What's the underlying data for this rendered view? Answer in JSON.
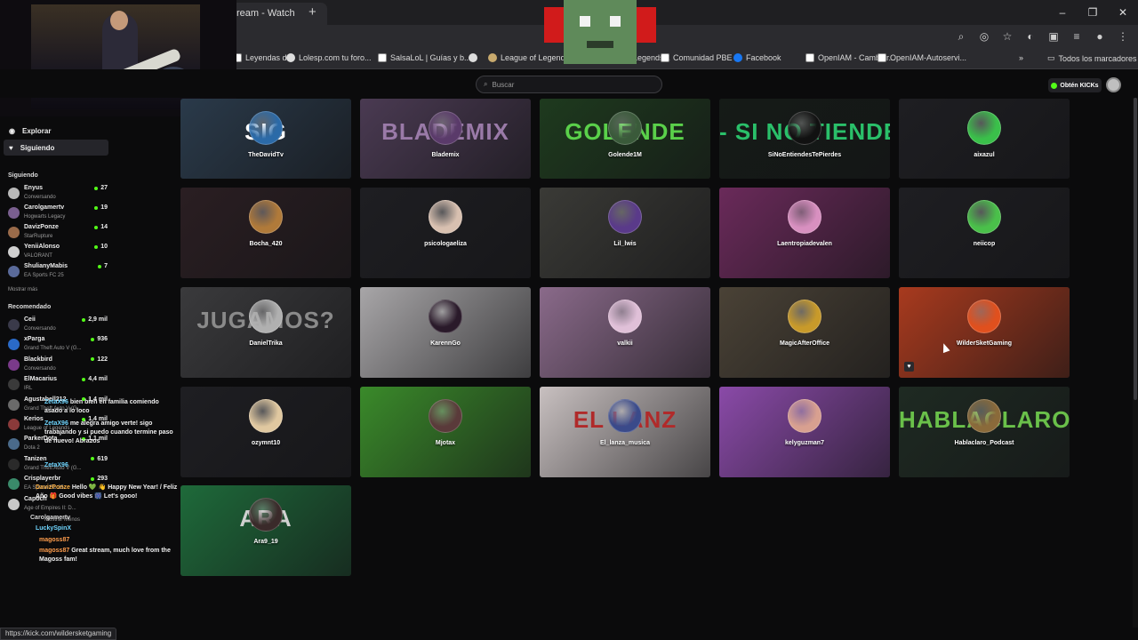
{
  "browser": {
    "tab_title": "ream - Watch",
    "tab_close": "×",
    "new_tab": "+",
    "window_controls": [
      "–",
      "❐",
      "✕"
    ],
    "toolbar_icons": [
      "zoom-icon",
      "eye-off-icon",
      "star-icon",
      "extension-icon",
      "puzzle-icon",
      "tabs-icon",
      "profile-icon",
      "menu-icon"
    ],
    "bookmarks": [
      {
        "label": "Leyendas d...",
        "icon": "sq"
      },
      {
        "label": "Lolesp.com tu foro...",
        "icon": "circle"
      },
      {
        "label": "SalsaLoL | Guías y b...",
        "icon": "sq"
      },
      {
        "label": "",
        "icon": "circle"
      },
      {
        "label": "League of Legends",
        "icon": "lol"
      },
      {
        "label": "Legends...",
        "icon": "circle"
      },
      {
        "label": "Comunidad PBE",
        "icon": "sq"
      },
      {
        "label": "Facebook",
        "icon": "fb"
      },
      {
        "label": "OpenIAM - Cambiar...",
        "icon": "sq"
      },
      {
        "label": "OpenIAM-Autoservi...",
        "icon": "sq"
      }
    ],
    "bookmarks_overflow": "»",
    "all_bookmarks": "Todos los marcadores",
    "status_url": "https://kick.com/wildersketgaming"
  },
  "header": {
    "search_placeholder": "Buscar",
    "kicks_button": "Obtén KICKs"
  },
  "sidebar": {
    "nav": [
      {
        "label": "Explorar",
        "icon": "compass-icon"
      },
      {
        "label": "Siguiendo",
        "icon": "heart-icon"
      }
    ],
    "following_title": "Siguiendo",
    "following": [
      {
        "name": "Enyus",
        "game": "Conversando",
        "viewers": "27",
        "color": "#b9b9b9"
      },
      {
        "name": "Carolgamertv",
        "game": "Hogwarts Legacy",
        "viewers": "19",
        "color": "#7a5f8f"
      },
      {
        "name": "DavizPonze",
        "game": "StarRupture",
        "viewers": "14",
        "color": "#9a6b4a"
      },
      {
        "name": "YeniiAlonso",
        "game": "VALORANT",
        "viewers": "10",
        "color": "#d0d0d0"
      },
      {
        "name": "ShulianyMabis",
        "game": "EA Sports FC 25",
        "viewers": "7",
        "color": "#5a6a9a"
      }
    ],
    "show_more": "Mostrar más",
    "recommended_title": "Recomendado",
    "recommended": [
      {
        "name": "Ceii",
        "game": "Conversando",
        "viewers": "2,9 mil",
        "color": "#3a3a4a"
      },
      {
        "name": "xParga",
        "game": "Grand Theft Auto V (G...",
        "viewers": "936",
        "color": "#2a6ac8"
      },
      {
        "name": "Blackbird",
        "game": "Conversando",
        "viewers": "122",
        "color": "#7a3a8a"
      },
      {
        "name": "ElMacarius",
        "game": "IRL",
        "viewers": "4,4 mil",
        "color": "#3a3a3a"
      },
      {
        "name": "Agustabell212",
        "game": "Grand Theft Auto V (G...",
        "viewers": "1,4 mil",
        "color": "#6a6a6a"
      },
      {
        "name": "Kerios",
        "game": "League of Legends",
        "viewers": "1,4 mil",
        "color": "#8a3a3a"
      },
      {
        "name": "ParkerDota",
        "game": "Dota 2",
        "viewers": "1,1 mil",
        "color": "#4a6a8a"
      },
      {
        "name": "Tanizen",
        "game": "Grand Theft Auto V (G...",
        "viewers": "619",
        "color": "#2a2a2a"
      },
      {
        "name": "Crisplayerbr",
        "game": "EA Sports FC 25",
        "viewers": "293",
        "color": "#3a8a6a"
      },
      {
        "name": "Capoch",
        "game": "Age of Empires II: D...",
        "viewers": "",
        "color": "#c8c8c8"
      }
    ],
    "show_less": "Mostrar Menos"
  },
  "chat": [
    {
      "user": "ZetaX96",
      "text": "bien bien en familia comiendo asado a lo loco",
      "color": "#6fd6ff"
    },
    {
      "user": "ZetaX96",
      "text": "me alegra amigo verte! sigo trabajando y si puedo cuando termine paso de nuevo! Abrazos",
      "color": "#6fd6ff"
    },
    {
      "user": "ZetaX96",
      "text": "",
      "color": "#6fd6ff"
    },
    {
      "user": "DavizPonze",
      "text": "Hello 💚 👋 Happy New Year! / Feliz Año 🎁 Good vibes 🎆 Let's gooo!",
      "color": "#ffb347"
    },
    {
      "user": "Carolgamertv",
      "text": "",
      "color": "#d9d9d9"
    },
    {
      "user": "LuckySpinX",
      "text": "",
      "color": "#6fd6ff"
    },
    {
      "user": "magoss87",
      "text": "",
      "color": "#ff9d4d"
    },
    {
      "user": "magoss87",
      "text": "Great stream, much love from the Magoss fam!",
      "color": "#ff9d4d"
    }
  ],
  "channels": [
    {
      "name": "TheDavidTv",
      "banner": "SIG",
      "bg": "#2a3a4a",
      "fg": "#ffffff",
      "av": "#2b6aa8"
    },
    {
      "name": "Blademix",
      "banner": "BLADEMIX",
      "bg": "#4a3a52",
      "fg": "#9a7aa8",
      "av": "#5a3a6a"
    },
    {
      "name": "Golende1M",
      "banner": "GOLENDE",
      "bg": "#1e3a1e",
      "fg": "#5ad04a",
      "av": "#3a5a3a"
    },
    {
      "name": "SiNoEntiendesTePierdes",
      "banner": "- SI NO TIENDES",
      "bg": "#151b17",
      "fg": "#2ac06a",
      "av": "#111111"
    },
    {
      "name": "aixazul",
      "banner": "",
      "bg": "#1e1e22",
      "fg": "#ffffff",
      "av": "#3ac04a"
    },
    {
      "name": "Bocha_420",
      "banner": "",
      "bg": "#2a1e22",
      "fg": "#ffffff",
      "av": "#b07a3a"
    },
    {
      "name": "psicologaeliza",
      "banner": "",
      "bg": "#1e1e22",
      "fg": "#ffffff",
      "av": "#d8c0b0"
    },
    {
      "name": "Lil_lwis",
      "banner": "",
      "bg": "#3a3a36",
      "fg": "#ffffff",
      "av": "#5a3a8a"
    },
    {
      "name": "Laentropiadevalen",
      "banner": "",
      "bg": "#6a2a5a",
      "fg": "#ffffff",
      "av": "#d890c0"
    },
    {
      "name": "neiicop",
      "banner": "",
      "bg": "#1e1e22",
      "fg": "#ffffff",
      "av": "#4ac04a"
    },
    {
      "name": "DanielTrika",
      "banner": "JUGAMOS?",
      "bg": "#3a3a3c",
      "fg": "#8a8a8a",
      "av": "#b0b0b0"
    },
    {
      "name": "KarennGo",
      "banner": "",
      "bg": "#a8a6a8",
      "fg": "#ffffff",
      "av": "#2a1a2a"
    },
    {
      "name": "valkii",
      "banner": "",
      "bg": "#8a6a8a",
      "fg": "#ffffff",
      "av": "#e0c0d8"
    },
    {
      "name": "MagicAfterOffice",
      "banner": "",
      "bg": "#4a4236",
      "fg": "#ffffff",
      "av": "#c89a2a"
    },
    {
      "name": "WilderSketGaming",
      "banner": "",
      "bg": "#a83a1e",
      "fg": "#ffffff",
      "av": "#e0501e"
    },
    {
      "name": "ozymnt10",
      "banner": "",
      "bg": "#1e1e22",
      "fg": "#ffffff",
      "av": "#e0c8a0"
    },
    {
      "name": "Mjotax",
      "banner": "",
      "bg": "#3a8a2a",
      "fg": "#ffffff",
      "av": "#5a3a3a"
    },
    {
      "name": "El_lanza_musica",
      "banner": "EL LANZ",
      "bg": "#c8c0c0",
      "fg": "#b02a2a",
      "av": "#3a4a8a"
    },
    {
      "name": "kelyguzman7",
      "banner": "",
      "bg": "#8a4aa8",
      "fg": "#ffffff",
      "av": "#d8a090"
    },
    {
      "name": "Hablaclaro_Podcast",
      "banner": "HABLACLARO",
      "bg": "#1e2a22",
      "fg": "#6ac04a",
      "av": "#8a6a3a"
    },
    {
      "name": "Ara9_19",
      "banner": "ARA",
      "bg": "#1e6a3a",
      "fg": "#d0d0d0",
      "av": "#3a2a2a"
    }
  ]
}
